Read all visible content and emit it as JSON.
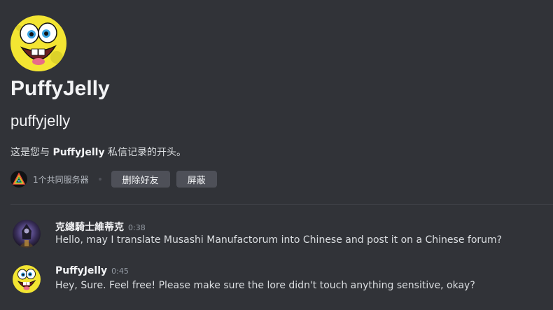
{
  "profile": {
    "display_name": "PuffyJelly",
    "username": "puffyjelly",
    "intro_prefix": "这是您与 ",
    "intro_name": "PuffyJelly",
    "intro_suffix": " 私信记录的开头。",
    "mutual_servers": "1个共同服务器",
    "remove_friend_label": "删除好友",
    "block_label": "屏蔽"
  },
  "messages": [
    {
      "author": "克總騎士維蒂克",
      "time": "0:38",
      "text": "Hello, may I translate Musashi Manufactorum into Chinese and post it on a Chinese forum?"
    },
    {
      "author": "PuffyJelly",
      "time": "0:45",
      "text": "Hey, Sure. Feel free! Please make sure the lore didn't touch anything sensitive, okay?"
    }
  ],
  "colors": {
    "background": "#313338",
    "button": "#4e5058",
    "text_primary": "#f2f3f5",
    "text_muted": "#949ba4"
  }
}
